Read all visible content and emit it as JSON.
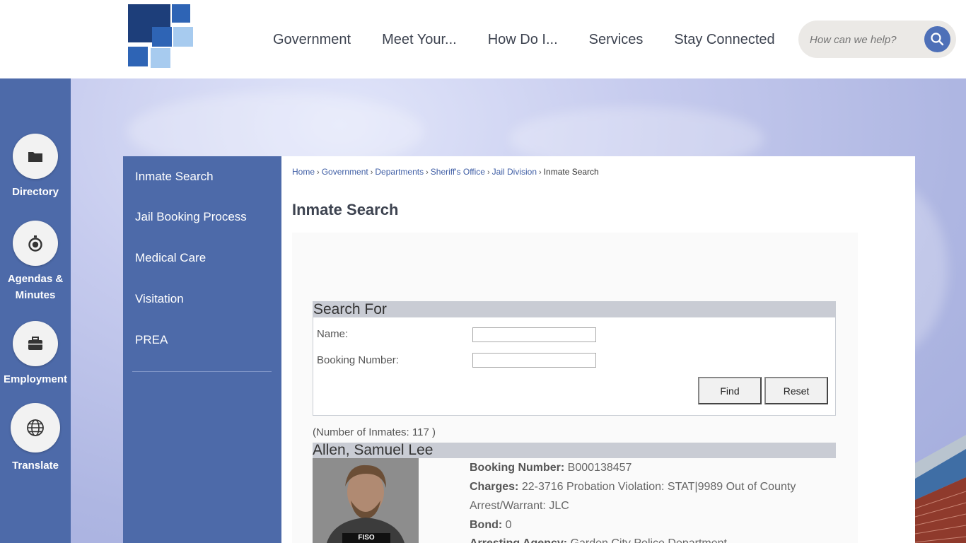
{
  "header": {
    "nav": [
      "Government",
      "Meet Your...",
      "How Do I...",
      "Services",
      "Stay Connected"
    ],
    "search_placeholder": "How can we help?"
  },
  "rail": [
    {
      "label": "Directory",
      "icon": "folder-icon"
    },
    {
      "label": "Agendas & Minutes",
      "icon": "timer-icon"
    },
    {
      "label": "Employment",
      "icon": "briefcase-icon"
    },
    {
      "label": "Translate",
      "icon": "globe-icon"
    }
  ],
  "sidenav": [
    "Inmate Search",
    "Jail Booking Process",
    "Medical Care",
    "Visitation",
    "PREA"
  ],
  "breadcrumb": [
    "Home",
    "Government",
    "Departments",
    "Sheriff's Office",
    "Jail Division"
  ],
  "breadcrumb_current": "Inmate Search",
  "page_title": "Inmate Search",
  "search": {
    "heading": "Search For",
    "name_label": "Name:",
    "name_value": "",
    "booking_label": "Booking Number:",
    "booking_value": "",
    "find_label": "Find",
    "reset_label": "Reset"
  },
  "results": {
    "count_text": "(Number of Inmates: 117 )",
    "inmate": {
      "name": "Allen, Samuel Lee",
      "booking_label": "Booking Number:",
      "booking_value": "B000138457",
      "charges_label": "Charges:",
      "charges_value_line1": "22-3716 Probation Violation: STAT|9989 Out of County",
      "charges_value_line2": "Arrest/Warrant: JLC",
      "bond_label": "Bond:",
      "bond_value": "0",
      "agency_label": "Arresting Agency:",
      "agency_value": "Garden City Police Department",
      "photo_tag": "FISO"
    }
  },
  "colors": {
    "brand_blue": "#4d6aa9",
    "logo_dark": "#1d3e7a",
    "logo_mid": "#2e64b5",
    "logo_light": "#a7cbef",
    "section_header": "#c9ccd4",
    "search_button": "#4e70b8"
  }
}
